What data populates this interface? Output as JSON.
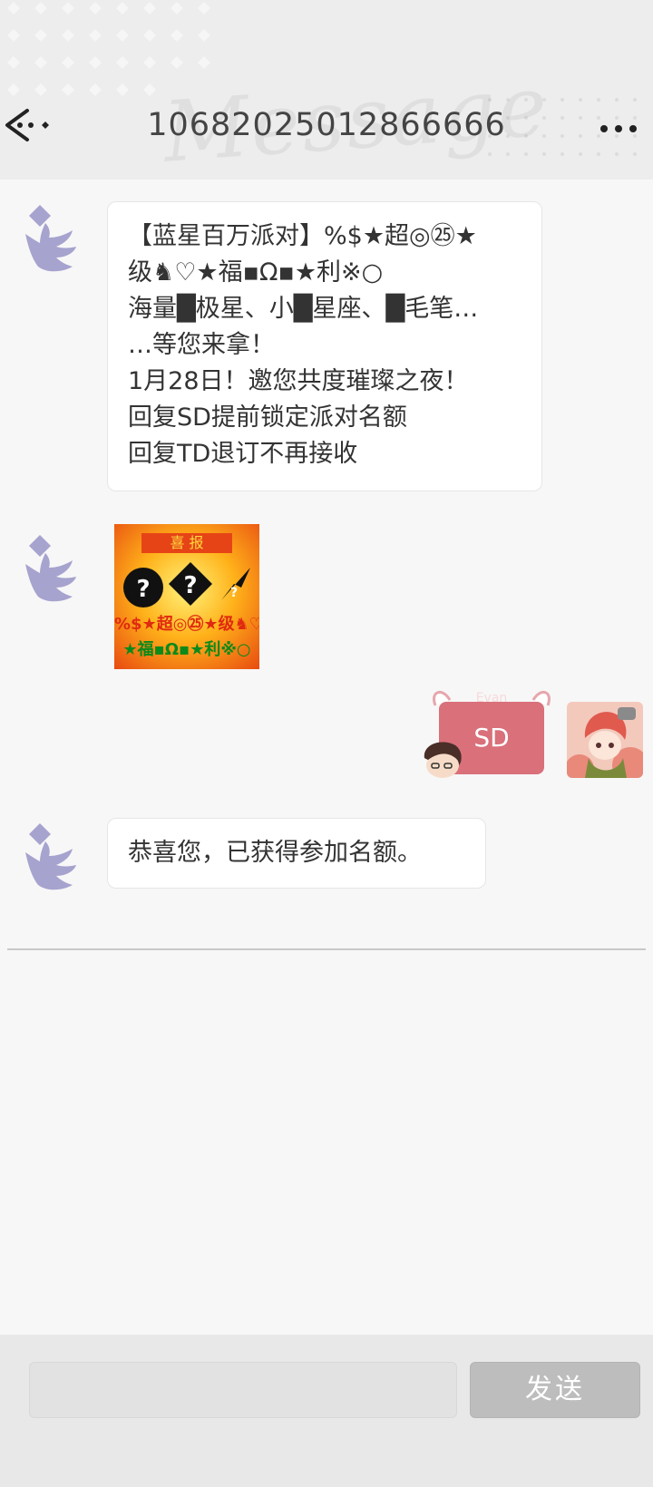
{
  "header": {
    "title": "10682025012866666",
    "watermark": "Message",
    "back_icon": "back-arrow-icon",
    "more_icon": "more-dots-icon"
  },
  "messages": [
    {
      "direction": "incoming",
      "lines": [
        "【蓝星百万派对】%$★超◎㉕★",
        "级♞♡★福▪Ω▪★利※○",
        "海量█极星、小█星座、█毛笔…",
        "…等您来拿！",
        "1月28日！邀您共度璀璨之夜！",
        "回复SD提前锁定派对名额",
        "回复TD退订不再接收"
      ]
    },
    {
      "direction": "incoming",
      "image": {
        "banner": "喜 报",
        "line1": "%$★超◎㉕★级♞♡",
        "line2": "★福▪Ω▪★利※○"
      }
    },
    {
      "direction": "outgoing",
      "sticker": {
        "name_tag": "Evan",
        "text": "SD"
      }
    },
    {
      "direction": "incoming",
      "text": "恭喜您，已获得参加名额。"
    }
  ],
  "input_bar": {
    "input_value": "",
    "send_label": "发送"
  },
  "colors": {
    "header_bg": "#ededed",
    "bubble_bg": "#ffffff",
    "avatar_purple": "#a6a3cf",
    "send_button": "#bdbdbd",
    "sticker_pink": "#d9707a"
  }
}
